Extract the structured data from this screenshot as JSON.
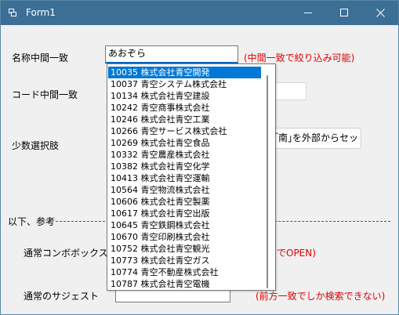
{
  "window": {
    "title": "Form1"
  },
  "labels": {
    "name_partial": "名称中間一致",
    "code_partial": "コード中間一致",
    "few_choices": "少数選択肢",
    "reference": "以下、参考",
    "normal_combobox": "通常コンボボックス",
    "normal_suggest": "通常のサジェスト"
  },
  "notes": {
    "name_partial": "(中間一致で絞り込み可能)",
    "normal_combobox": "でOPEN)",
    "normal_suggest": "(前方一致でしか検索できない)"
  },
  "inputs": {
    "name_value": "あおぞら"
  },
  "buttons": {
    "set_external": "｢南｣を外部からセット"
  },
  "dropdown": {
    "selected_index": 0,
    "items": [
      "10035 株式会社青空開発",
      "10037 青空システム株式会社",
      "10134 株式会社青空建設",
      "10242 青空商事株式会社",
      "10246 株式会社青空工業",
      "10266 青空サービス株式会社",
      "10269 株式会社青空食品",
      "10332 青空農産株式会社",
      "10382 株式会社青空化学",
      "10413 株式会社青空運輸",
      "10564 青空物流株式会社",
      "10606 株式会社青空製薬",
      "10617 株式会社青空出版",
      "10645 青空鉄鋼株式会社",
      "10670 青空印刷株式会社",
      "10752 株式会社青空観光",
      "10773 株式会社青空ガス",
      "10774 青空不動産株式会社",
      "10787 株式会社青空電機"
    ]
  },
  "colors": {
    "titlebar": "#3c6f96",
    "selection": "#0078d7",
    "note_red": "#e00000"
  }
}
